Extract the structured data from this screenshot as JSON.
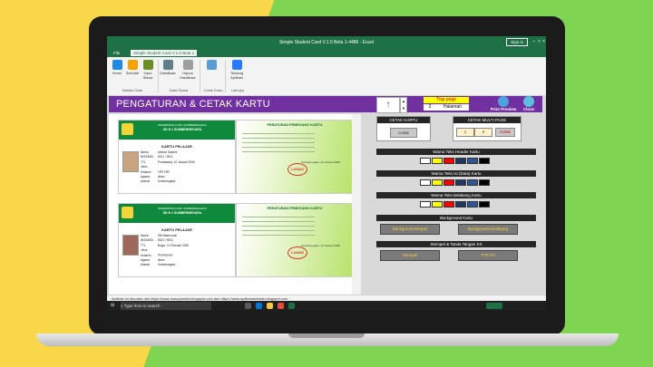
{
  "excel": {
    "title": "Simple Student Card V.1.0 Beta 1-4486 - Excel",
    "sign_in": "Sign in",
    "tabs": [
      "File",
      "Simple Student Card V.1.0 Beta 1"
    ],
    "ribbon": {
      "buttons": [
        "Home",
        "Sekolah",
        "Input Siswa",
        "DataBase",
        "Hapus DataBase",
        "",
        "Tentang Aplikasi"
      ],
      "groups": [
        "Master Data",
        "Data Siswa",
        "Cetak Kartu",
        "Lainnya"
      ]
    },
    "status_text": ": Aplikasi ini diunduh dari https://www.masoperator.blogspot.com dan https://www.aplikasisekolah.blogspot.com"
  },
  "header": {
    "title": "PENGATURAN & CETAK KARTU",
    "arrow": "↑",
    "page_label": "Tiap page",
    "page_num": "2",
    "page_unit": "Halaman",
    "print_preview": "Print Preview",
    "close": "Close"
  },
  "cards": [
    {
      "front": {
        "school_line1": "PEMERINTAH KAB. SUMBERNEGARA",
        "school_line2": "SD N 1 SUMBERNEGARA",
        "title": "KARTU PELAJAR",
        "rows": [
          [
            "Nama",
            "Ahmad Sulaeni"
          ],
          [
            "NIS/NISN",
            "0001 / 9921"
          ],
          [
            "TTL",
            "Purwakarta, 10 Januari 2006"
          ],
          [
            "Jenis Kelamin",
            "Laki-Laki"
          ],
          [
            "Agama",
            "Islam"
          ],
          [
            "Alamat",
            "Sumberagara"
          ]
        ]
      },
      "back": {
        "title": "PERATURAN PEMEGANG KARTU",
        "stamp": "LUNAS",
        "sign": "Sumbernegara, 12 Januari 2020"
      }
    },
    {
      "front": {
        "school_line1": "PEMERINTAH KAB. SUMBERNEGARA",
        "school_line2": "SD N 1 SUMBERNEGARA",
        "title": "KARTU PELAJAR",
        "rows": [
          [
            "Nama",
            "Siti Maemunah"
          ],
          [
            "NIS/NISN",
            "0002 / 9922"
          ],
          [
            "TTL",
            "Bogor, 11 Februari 2006"
          ],
          [
            "Jenis Kelamin",
            "Perempuan"
          ],
          [
            "Agama",
            "Islam"
          ],
          [
            "Alamat",
            "Sumberagara"
          ]
        ]
      },
      "back": {
        "title": "PERATURAN PEMEGANG KARTU",
        "stamp": "LUNAS",
        "sign": "Sumbernegara, 12 Januari 2020"
      }
    }
  ],
  "panel": {
    "cetak_kartu": "CETAK KARTU",
    "cetak_btn": "Cetak",
    "cetak_multi": "CETAK MULTI PAGE",
    "multi_from": "1",
    "multi_to": "2",
    "multi_btn": "Cetak",
    "warna_header": "Warna Teks Header Kartu",
    "warna_isi": "Warna Teks Isi (Data) Kartu",
    "warna_belakang": "Warna Teks Belakang Kartu",
    "bg_kartu": "Background Kartu",
    "bg_depan": "Background Depan",
    "bg_belakang": "Background Belakang",
    "stempel": "Stempel & Tanda Tangan KS",
    "stempel_btn": "Stempel",
    "ttd_btn": "TTD KS"
  },
  "swatches": [
    "#ffffff",
    "#ffff00",
    "#ff0000",
    "#1f3864",
    "#2f5597",
    "#000000"
  ],
  "taskbar": {
    "search": "Type here to search"
  }
}
